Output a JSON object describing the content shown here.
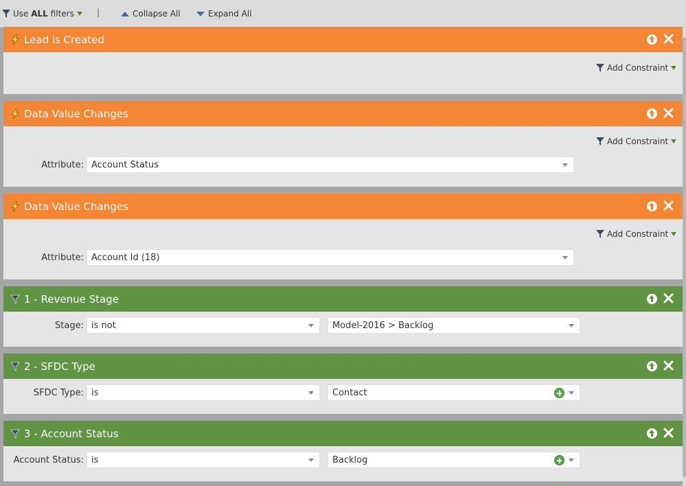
{
  "toolbar": {
    "use_all_prefix": "Use",
    "use_all_bold": "ALL",
    "use_all_suffix": "filters",
    "separator": "|",
    "collapse_label": "Collapse All",
    "expand_label": "Expand All"
  },
  "add_constraint_label": "Add Constraint",
  "cards": [
    {
      "title": "Lead is Created",
      "kind": "trigger"
    },
    {
      "title": "Data Value Changes",
      "kind": "trigger",
      "field_label": "Attribute:",
      "value": "Account Status"
    },
    {
      "title": "Data Value Changes",
      "kind": "trigger",
      "field_label": "Attribute:",
      "value": "Account Id (18)"
    },
    {
      "title": "1 - Revenue Stage",
      "kind": "filter",
      "field_label": "Stage:",
      "operator": "is not",
      "value": "Model-2016 > Backlog"
    },
    {
      "title": "2 - SFDC Type",
      "kind": "filter",
      "field_label": "SFDC Type:",
      "operator": "is",
      "value": "Contact"
    },
    {
      "title": "3 - Account Status",
      "kind": "filter",
      "field_label": "Account Status:",
      "operator": "is",
      "value": "Backlog"
    }
  ],
  "colors": {
    "trigger_header": "#f58634",
    "filter_header": "#5f9443",
    "panel_bg": "#e5e5e5",
    "page_bg": "#a6a6a6"
  },
  "icons": [
    "funnel-icon",
    "lightning-icon",
    "close-icon",
    "arrow-up-icon",
    "plus-icon",
    "dropdown-caret-icon"
  ]
}
